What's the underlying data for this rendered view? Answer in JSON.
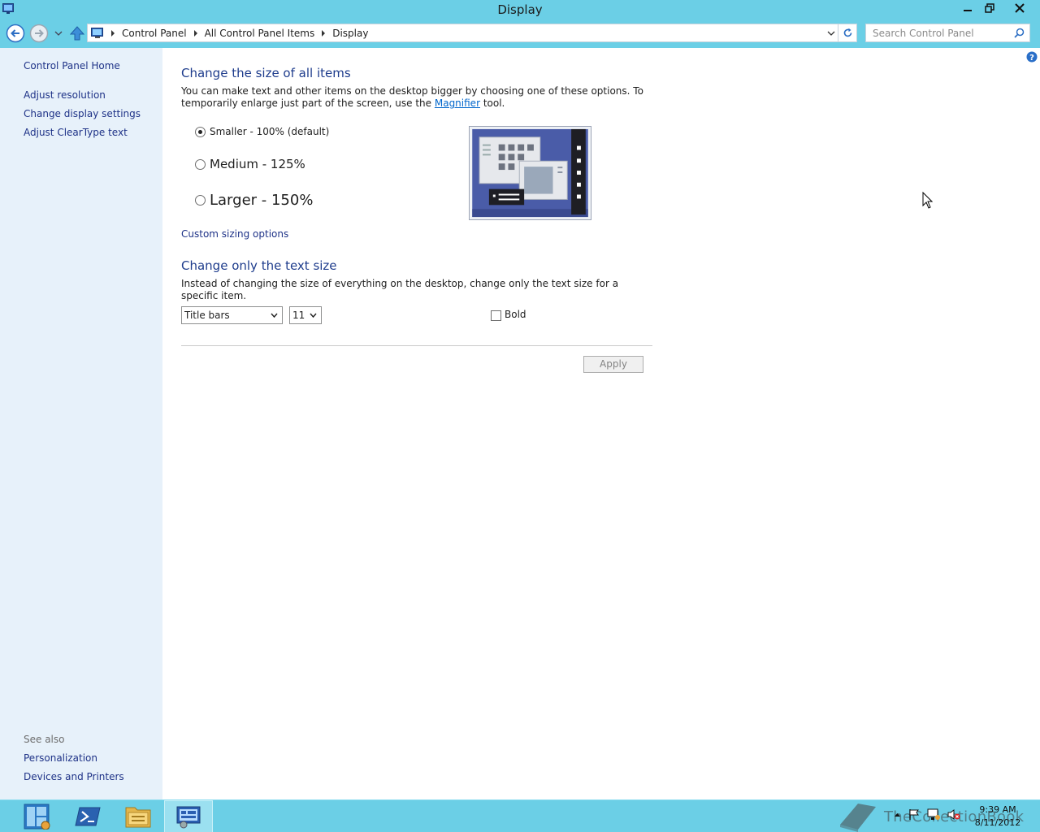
{
  "window": {
    "title": "Display",
    "minimize_icon": "minimize-icon",
    "restore_icon": "restore-icon",
    "close_icon": "close-icon"
  },
  "address_bar": {
    "crumbs": [
      "Control Panel",
      "All Control Panel Items",
      "Display"
    ],
    "search_placeholder": "Search Control Panel"
  },
  "sidebar": {
    "home_link": "Control Panel Home",
    "links": [
      "Adjust resolution",
      "Change display settings",
      "Adjust ClearType text"
    ],
    "see_also_heading": "See also",
    "see_also_links": [
      "Personalization",
      "Devices and Printers"
    ]
  },
  "main": {
    "size_heading": "Change the size of all items",
    "size_description_part1": "You can make text and other items on the desktop bigger by choosing one of these options. To temporarily enlarge just part of the screen, use the ",
    "magnifier_link": "Magnifier",
    "size_description_part2": " tool.",
    "options": [
      {
        "label": "Smaller - 100% (default)",
        "checked": true
      },
      {
        "label": "Medium - 125%",
        "checked": false
      },
      {
        "label": "Larger - 150%",
        "checked": false
      }
    ],
    "custom_sizing_link": "Custom sizing options",
    "text_heading": "Change only the text size",
    "text_description": "Instead of changing the size of everything on the desktop, change only the text size for a specific item.",
    "item_select_value": "Title bars",
    "size_select_value": "11",
    "bold_label": "Bold",
    "bold_checked": false,
    "apply_label": "Apply"
  },
  "taskbar": {
    "buttons": [
      "server-manager-icon",
      "powershell-icon",
      "file-explorer-icon",
      "control-panel-icon"
    ],
    "active_button": "control-panel-icon",
    "watermark_text": "TheCollectionBook",
    "clock_time": "9:39 AM",
    "clock_date": "8/11/2012"
  },
  "colors": {
    "chrome": "#6bcfe6",
    "sidebar": "#e7f1fa",
    "heading": "#1e3c8c",
    "link": "#1e3287"
  }
}
